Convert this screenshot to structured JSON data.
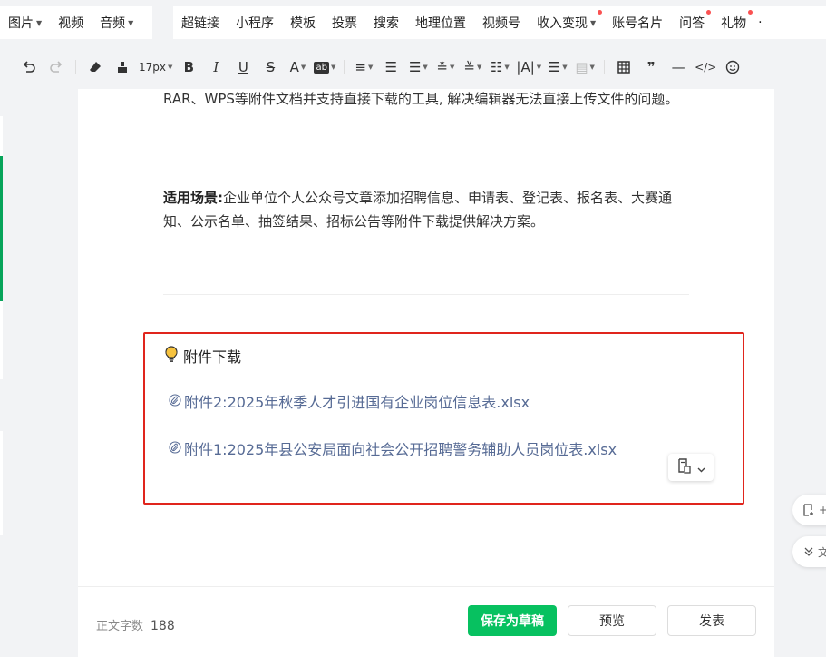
{
  "menu_left": [
    {
      "label": "图片",
      "caret": true
    },
    {
      "label": "视频",
      "caret": false
    },
    {
      "label": "音频",
      "caret": true
    }
  ],
  "menu_right": [
    {
      "label": "超链接",
      "caret": false,
      "dot": false
    },
    {
      "label": "小程序",
      "caret": false,
      "dot": false
    },
    {
      "label": "模板",
      "caret": false,
      "dot": false
    },
    {
      "label": "投票",
      "caret": false,
      "dot": false
    },
    {
      "label": "搜索",
      "caret": false,
      "dot": false
    },
    {
      "label": "地理位置",
      "caret": false,
      "dot": false
    },
    {
      "label": "视频号",
      "caret": false,
      "dot": false
    },
    {
      "label": "收入变现",
      "caret": true,
      "dot": true
    },
    {
      "label": "账号名片",
      "caret": false,
      "dot": false
    },
    {
      "label": "问答",
      "caret": false,
      "dot": true
    },
    {
      "label": "礼物",
      "caret": false,
      "dot": true
    }
  ],
  "toolbar": {
    "undo": "undo-icon",
    "redo": "redo-icon",
    "font_size": "17px"
  },
  "content": {
    "para1": "RAR、WPS等附件文档并支持直接下载的工具, 解决编辑器无法直接上传文件的问题。",
    "para2_label": "适用场景:",
    "para2_text": "企业单位个人公众号文章添加招聘信息、申请表、登记表、报名表、大赛通知、公示名单、抽签结果、招标公告等附件下载提供解决方案。"
  },
  "attachment": {
    "title": "附件下载",
    "links": [
      "附件2:2025年秋季人才引进国有企业岗位信息表.xlsx",
      "附件1:2025年县公安局面向社会公开招聘警务辅助人员岗位表.xlsx"
    ]
  },
  "right_pills": [
    "+",
    "文"
  ],
  "footer": {
    "word_count_label": "正文字数",
    "word_count": "188",
    "save_draft": "保存为草稿",
    "preview": "预览",
    "publish": "发表"
  },
  "colors": {
    "accent_green": "#07c160",
    "link_blue": "#576b95",
    "highlight_red": "#e0251d",
    "dot_red": "#fa5151"
  }
}
